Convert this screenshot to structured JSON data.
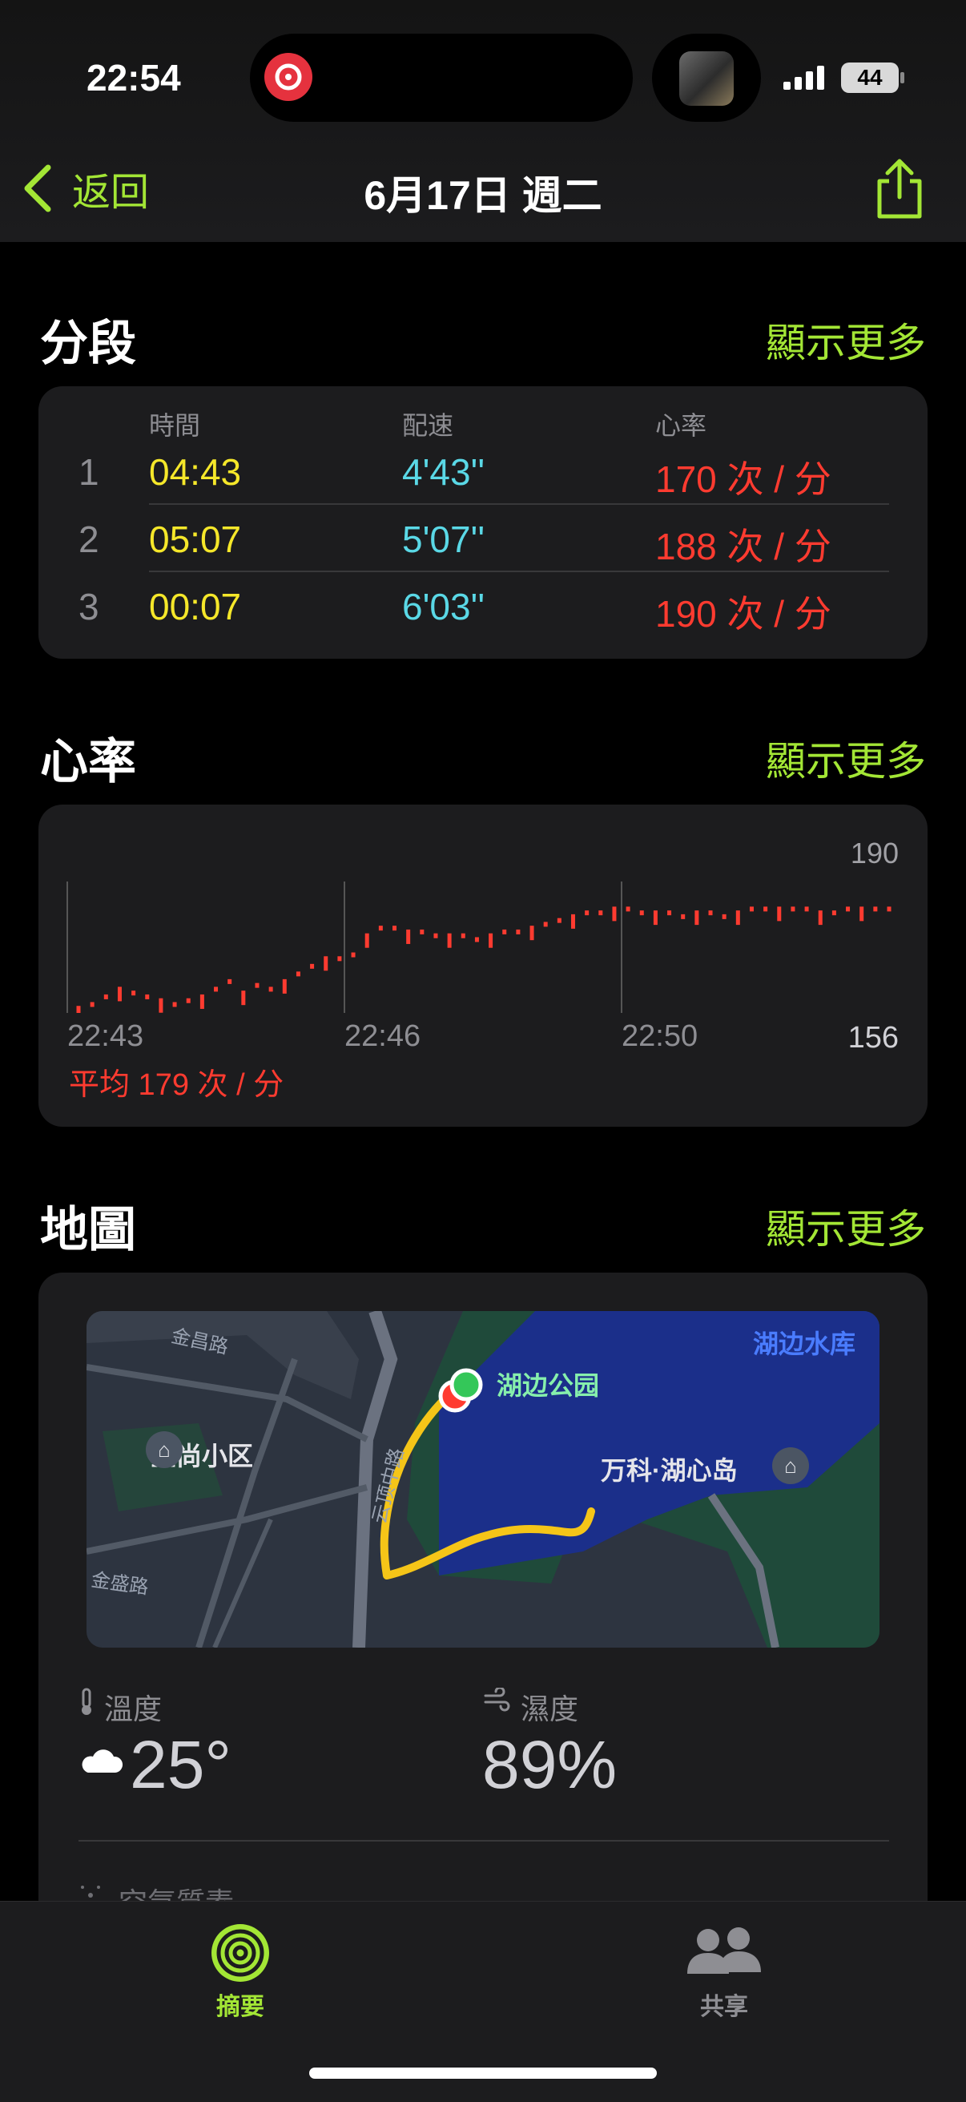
{
  "status": {
    "time": "22:54",
    "battery": "44"
  },
  "nav": {
    "back_label": "返回",
    "title": "6月17日 週二"
  },
  "splits": {
    "title": "分段",
    "more": "顯示更多",
    "headers": {
      "time": "時間",
      "pace": "配速",
      "hr": "心率"
    },
    "rows": [
      {
        "n": "1",
        "time": "04:43",
        "pace": "4'43''",
        "hr": "170 次 / 分"
      },
      {
        "n": "2",
        "time": "05:07",
        "pace": "5'07''",
        "hr": "188 次 / 分"
      },
      {
        "n": "3",
        "time": "00:07",
        "pace": "6'03''",
        "hr": "190 次 / 分"
      }
    ]
  },
  "heart": {
    "title": "心率",
    "more": "顯示更多",
    "max_label": "190",
    "min_label": "156",
    "x_labels": [
      "22:43",
      "22:46",
      "22:50"
    ],
    "avg": "平均 179 次 / 分",
    "color": "#ff3b30"
  },
  "chart_data": {
    "type": "scatter",
    "title": "",
    "xlabel": "",
    "ylabel": "",
    "ylim": [
      156,
      190
    ],
    "x_tick_labels": [
      "22:43",
      "22:46",
      "22:50"
    ],
    "y_tick_labels": [
      "156",
      "190"
    ],
    "series": [
      {
        "values": [
          157,
          158,
          160,
          162,
          161,
          160,
          159,
          158,
          159,
          160,
          162,
          164,
          161,
          163,
          162,
          164,
          166,
          168,
          170,
          170,
          171,
          176,
          178,
          178,
          177,
          177,
          176,
          176,
          176,
          175,
          176,
          177,
          177,
          178,
          179,
          180,
          181,
          182,
          182,
          183,
          183,
          182,
          182,
          182,
          181,
          182,
          182,
          181,
          182,
          183,
          183,
          183,
          183,
          183,
          182,
          182,
          183,
          183,
          183,
          183
        ]
      }
    ]
  },
  "map": {
    "title": "地圖",
    "more": "顯示更多",
    "labels": {
      "park": "湖边公园",
      "reservoir": "湖边水库",
      "community": "金尚小区",
      "island": "万科·湖心岛",
      "road1": "金昌路",
      "road2": "金盛路",
      "road3": "云顶中路"
    }
  },
  "weather": {
    "temp_label": "溫度",
    "temp_value": "25°",
    "humidity_label": "濕度",
    "humidity_value": "89%",
    "air_label": "空氣質素"
  },
  "tabs": [
    {
      "label": "摘要",
      "active": true,
      "color": "#a3e635"
    },
    {
      "label": "共享",
      "active": false,
      "color": "#8e8e93"
    }
  ]
}
